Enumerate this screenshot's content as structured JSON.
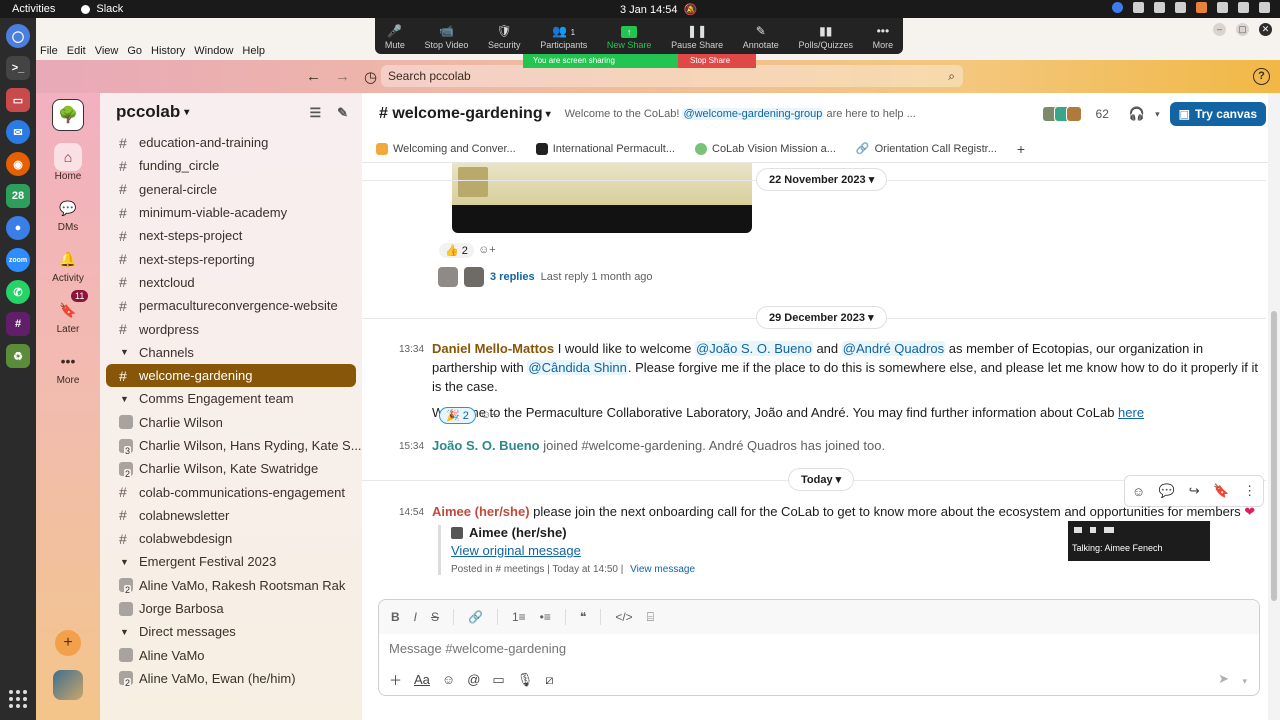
{
  "os": {
    "activities": "Activities",
    "app_name": "Slack",
    "clock": "3 Jan  14:54"
  },
  "menu": [
    "File",
    "Edit",
    "View",
    "Go",
    "History",
    "Window",
    "Help"
  ],
  "search": {
    "placeholder": "Search pccolab"
  },
  "rail": {
    "home": "Home",
    "dms": "DMs",
    "activity": "Activity",
    "later": "Later",
    "later_badge": "11",
    "more": "More"
  },
  "workspace": {
    "name": "pccolab"
  },
  "sidebar": {
    "channels_top": [
      "education-and-training",
      "funding_circle",
      "general-circle",
      "minimum-viable-academy",
      "next-steps-project",
      "next-steps-reporting",
      "nextcloud",
      "permacultureconvergence-website",
      "wordpress"
    ],
    "section_channels": "Channels",
    "active_channel": "welcome-gardening",
    "section_comms": "Comms Engagement team",
    "comms_items": [
      {
        "label": "Charlie Wilson",
        "count": ""
      },
      {
        "label": "Charlie Wilson, Hans Ryding, Kate S...",
        "count": "3"
      },
      {
        "label": "Charlie Wilson, Kate Swatridge",
        "count": "2"
      }
    ],
    "comms_channels": [
      "colab-communications-engagement",
      "colabnewsletter",
      "colabwebdesign"
    ],
    "section_emergent": "Emergent Festival 2023",
    "emergent_items": [
      {
        "label": "Aline VaMo, Rakesh Rootsman Rak",
        "count": "2"
      },
      {
        "label": "Jorge Barbosa",
        "count": ""
      }
    ],
    "section_dm": "Direct messages",
    "dm_items": [
      {
        "label": "Aline VaMo",
        "count": ""
      },
      {
        "label": "Aline VaMo, Ewan (he/him)",
        "count": "2"
      }
    ]
  },
  "channel": {
    "title": "# welcome-gardening",
    "topic_prefix": "Welcome to the CoLab!",
    "topic_mention": "@welcome-gardening-group",
    "topic_suffix": "are here to help ...",
    "member_count": "62",
    "try_canvas": "Try canvas",
    "bookmarks": [
      "Welcoming and Conver...",
      "International Permacult...",
      "CoLab Vision Mission a...",
      "Orientation Call Registr..."
    ],
    "bookmark_add": "+"
  },
  "messages": {
    "date1": "22 November 2023",
    "reaction1_emoji": "👍",
    "reaction1_count": "2",
    "replies": "3 replies",
    "last_reply": "Last reply 1 month ago",
    "date2": "29 December 2023",
    "m1_time": "13:34",
    "m1_author": "Daniel Mello-Mattos",
    "m1_t1": "I would like to welcome",
    "m1_mention1": "@João S. O. Bueno",
    "m1_t2": "and",
    "m1_mention2": "@André Quadros",
    "m1_t3": "as member of Ecotopias, our organization in parthership with",
    "m1_mention3": "@Cândida Shinn",
    "m1_t4": ". Please forgive me if the place to do this is somewhere else, and please let me know how to do it properly if it is the case.",
    "m1_t5": "Welcome to the Permaculture Collaborative Laboratory, João and André. You may find further information about CoLab",
    "m1_link": "here",
    "reaction2_emoji": "🎉",
    "reaction2_count": "2",
    "m2_time": "15:34",
    "m2_author": "João S. O. Bueno",
    "m2_text": "joined #welcome-gardening. André Quadros has joined too.",
    "date3": "Today",
    "m3_time": "14:54",
    "m3_author": "Aimee (her/she)",
    "m3_text": "please join the next onboarding call for the CoLab to get to know more about the ecosystem and opportunities for members",
    "quote_author": "Aimee (her/she)",
    "quote_link": "View original message",
    "quote_posted": "Posted in",
    "quote_channel": "# meetings",
    "quote_when": "Today at 14:50",
    "quote_view": "View message"
  },
  "composer": {
    "placeholder": "Message #welcome-gardening"
  },
  "zoom": {
    "items": [
      "Mute",
      "Stop Video",
      "Security",
      "Participants",
      "New Share",
      "Pause Share",
      "Annotate",
      "Polls/Quizzes",
      "More"
    ],
    "participants_count": "1",
    "sharing_banner": "You are screen sharing",
    "stop_share": "Stop Share",
    "talking": "Talking: Aimee Fenech"
  },
  "colors": {
    "accent": "#875609",
    "link": "#1264a3",
    "zoom_green": "#23c552",
    "zoom_red": "#e04848"
  }
}
